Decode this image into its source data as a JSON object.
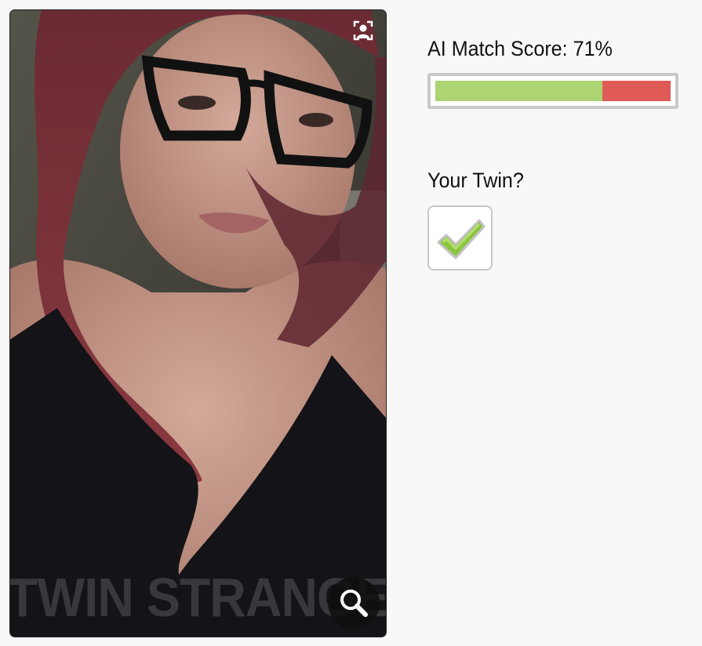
{
  "photo": {
    "watermark": "TWIN STRANGERS",
    "face_icon": "face-detect-icon",
    "zoom_icon": "magnifier-icon"
  },
  "match": {
    "score_label": "AI Match Score: 71%",
    "score_value": 71,
    "bar_colors": {
      "match": "#acd473",
      "remainder": "#e05a58",
      "border": "#c9c9c9"
    }
  },
  "twin": {
    "question": "Your Twin?",
    "checked": true,
    "check_icon": "checkmark-icon",
    "check_color": "#8bc53f"
  }
}
